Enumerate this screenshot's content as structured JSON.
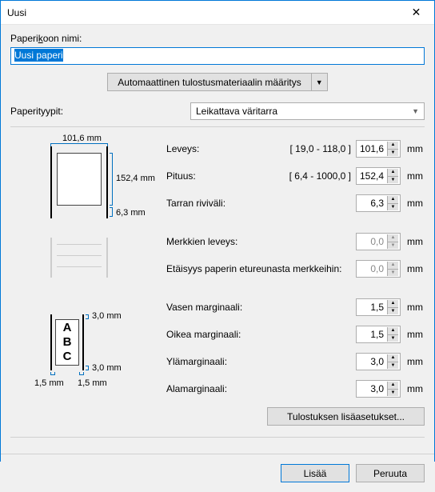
{
  "titlebar": {
    "title": "Uusi"
  },
  "name": {
    "label": "Paperikoon nimi:",
    "value": "Uusi paperi"
  },
  "auto": {
    "label": "Automaattinen tulostusmateriaalin määritys"
  },
  "papertype": {
    "label": "Paperityypit:",
    "selected": "Leikattava väritarra"
  },
  "diagram": {
    "width_label": "101,6 mm",
    "height_label": "152,4 mm",
    "gap_label": "6,3 mm",
    "margin_top_label": "3,0 mm",
    "margin_bottom_label": "3,0 mm",
    "margin_left_label": "1,5 mm",
    "margin_right_label": "1,5 mm",
    "abc": "A\nB\nC"
  },
  "fields": {
    "width": {
      "label": "Leveys:",
      "range": "[ 19,0 - 118,0 ]",
      "value": "101,6",
      "unit": "mm"
    },
    "length": {
      "label": "Pituus:",
      "range": "[ 6,4 - 1000,0 ]",
      "value": "152,4",
      "unit": "mm"
    },
    "label_spacing": {
      "label": "Tarran riviväli:",
      "value": "6,3",
      "unit": "mm"
    },
    "mark_width": {
      "label": "Merkkien leveys:",
      "value": "0,0",
      "unit": "mm"
    },
    "mark_distance": {
      "label": "Etäisyys paperin etureunasta merkkeihin:",
      "value": "0,0",
      "unit": "mm"
    },
    "left_margin": {
      "label": "Vasen marginaali:",
      "value": "1,5",
      "unit": "mm"
    },
    "right_margin": {
      "label": "Oikea marginaali:",
      "value": "1,5",
      "unit": "mm"
    },
    "top_margin": {
      "label": "Ylämarginaali:",
      "value": "3,0",
      "unit": "mm"
    },
    "bottom_margin": {
      "label": "Alamarginaali:",
      "value": "3,0",
      "unit": "mm"
    }
  },
  "buttons": {
    "print_advanced": "Tulostuksen lisäasetukset...",
    "add": "Lisää",
    "cancel": "Peruuta"
  }
}
